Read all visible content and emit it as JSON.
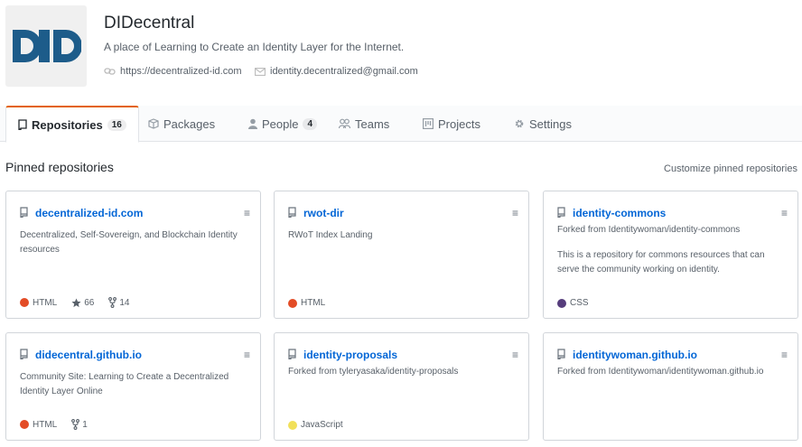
{
  "org": {
    "name": "DIDecentral",
    "description": "A place of Learning to Create an Identity Layer for the Internet.",
    "website": "https://decentralized-id.com",
    "email": "identity.decentralized@gmail.com",
    "logo_icon": "did-logo",
    "logo_color": "#1d5c8a"
  },
  "tabs": [
    {
      "label": "Repositories",
      "count": "16",
      "icon": "repo-icon",
      "selected": true
    },
    {
      "label": "Packages",
      "icon": "package-icon"
    },
    {
      "label": "People",
      "count": "4",
      "icon": "person-icon"
    },
    {
      "label": "Teams",
      "icon": "people-icon"
    },
    {
      "label": "Projects",
      "icon": "project-icon"
    },
    {
      "label": "Settings",
      "icon": "gear-icon"
    }
  ],
  "pinned": {
    "title": "Pinned repositories",
    "customize_label": "Customize pinned repositories",
    "repos": [
      {
        "name": "decentralized-id.com",
        "description": "Decentralized, Self-Sovereign, and Blockchain Identity resources",
        "language": "HTML",
        "lang_color": "#e34c26",
        "stars": "66",
        "forks": "14"
      },
      {
        "name": "rwot-dir",
        "description": "RWoT Index Landing",
        "language": "HTML",
        "lang_color": "#e34c26"
      },
      {
        "name": "identity-commons",
        "forked_from": "Forked from Identitywoman/identity-commons",
        "description": "This is a repository for commons resources that can serve the community working on identity.",
        "language": "CSS",
        "lang_color": "#563d7c"
      },
      {
        "name": "didecentral.github.io",
        "description": "Community Site: Learning to Create a Decentralized Identity Layer Online",
        "language": "HTML",
        "lang_color": "#e34c26",
        "forks": "1"
      },
      {
        "name": "identity-proposals",
        "forked_from": "Forked from tyleryasaka/identity-proposals",
        "language": "JavaScript",
        "lang_color": "#f1e05a"
      },
      {
        "name": "identitywoman.github.io",
        "forked_from": "Forked from Identitywoman/identitywoman.github.io"
      }
    ]
  }
}
